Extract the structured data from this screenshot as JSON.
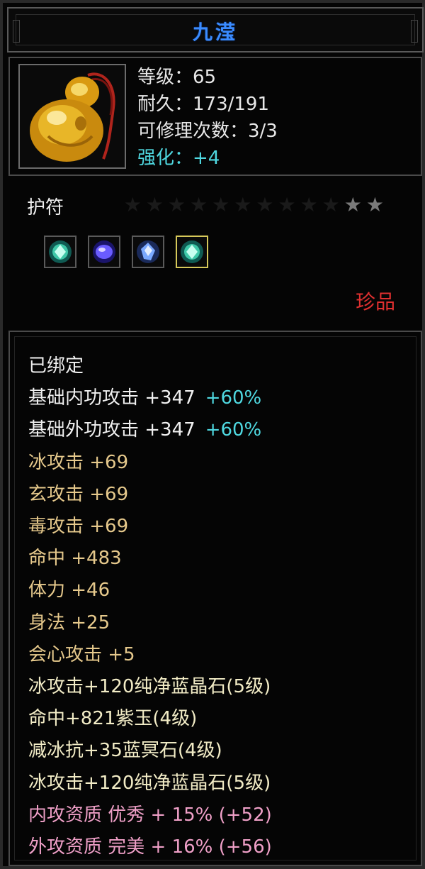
{
  "item": {
    "name": "九滢",
    "icon": "amulet-gourd-icon",
    "stats": [
      {
        "label": "等级：65"
      },
      {
        "label": "耐久：173/191"
      },
      {
        "label": "可修理次数：3/3"
      },
      {
        "label": "强化：+4"
      }
    ],
    "type": "护符",
    "stars": {
      "filled": 2,
      "total": 12
    },
    "gems": [
      {
        "icon": "green-crystal-gem-icon",
        "color": "#3ec8a8"
      },
      {
        "icon": "purple-jade-gem-icon",
        "color": "#6a5cff"
      },
      {
        "icon": "blue-crystal-gem-icon",
        "color": "#7aa8ff"
      },
      {
        "icon": "green-crystal-gem-icon",
        "color": "#3ec8a8"
      }
    ],
    "rarity": "珍品"
  },
  "attributes": {
    "bound": "已绑定",
    "base": [
      {
        "text": "基础内功攻击 +347",
        "pct": "+60%"
      },
      {
        "text": "基础外功攻击 +347",
        "pct": "+60%"
      }
    ],
    "bonus": [
      "冰攻击 +69",
      "玄攻击 +69",
      "毒攻击 +69",
      "命中 +483",
      "体力 +46",
      "身法 +25",
      "会心攻击 +5"
    ],
    "gems": [
      "冰攻击+120纯净蓝晶石(5级)",
      "命中+821紫玉(4级)",
      "减冰抗+35蓝冥石(4级)",
      "冰攻击+120纯净蓝晶石(5级)"
    ],
    "quality": [
      "内攻资质 优秀 + 15% (+52)",
      "外攻资质 完美 + 16% (+56)"
    ]
  },
  "colors": {
    "title": "#3a8bff",
    "enhance": "#4fd8e0",
    "rarity": "#e03030",
    "bonus": "#e6c98c",
    "quality": "#f0a0c8"
  }
}
